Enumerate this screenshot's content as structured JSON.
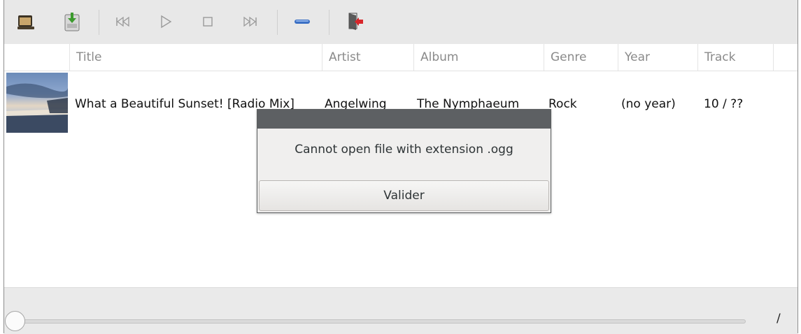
{
  "toolbar": {
    "buttons": [
      {
        "icon": "folder-icon"
      },
      {
        "icon": "download-icon"
      },
      {
        "icon": "previous-icon",
        "glyph": "⏮"
      },
      {
        "icon": "play-icon",
        "glyph": "▷"
      },
      {
        "icon": "stop-icon",
        "glyph": "□"
      },
      {
        "icon": "next-icon",
        "glyph": "⏭"
      },
      {
        "icon": "remove-icon"
      },
      {
        "icon": "exit-icon"
      }
    ]
  },
  "table": {
    "headers": [
      "Title",
      "Artist",
      "Album",
      "Genre",
      "Year",
      "Track"
    ],
    "rows": [
      {
        "title": "What a Beautiful Sunset! [Radio Mix]",
        "artist": "Angelwing",
        "album": "The Nymphaeum",
        "genre": "Rock",
        "year": "(no year)",
        "track": "10 / ??"
      }
    ]
  },
  "player": {
    "time": "/",
    "progress": 0
  },
  "dialog": {
    "message": "Cannot open file with extension .ogg",
    "button_label": "Valider"
  },
  "colors": {
    "toolbar_bg": "#e8e8e8",
    "dialog_title_bar": "#5d6063",
    "remove_icon": "#3a6fc4",
    "exit_arrow": "#d8262b"
  }
}
